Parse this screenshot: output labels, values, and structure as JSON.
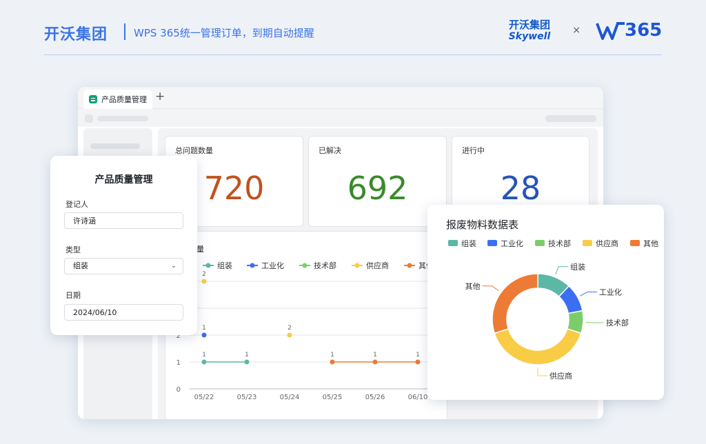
{
  "header": {
    "brand": "开沃集团",
    "subtitle": "WPS 365统一管理订单，到期自动提醒",
    "partner_cn": "开沃集团",
    "partner_en": "Skywell",
    "times": "×",
    "partner2": "365"
  },
  "window": {
    "tab_label": "产品质量管理",
    "tab_add": "+",
    "stats": [
      {
        "label": "总问题数量",
        "value": "720",
        "color": "#c0521c"
      },
      {
        "label": "已解决",
        "value": "692",
        "color": "#3a8a2a"
      },
      {
        "label": "进行中",
        "value": "28",
        "color": "#2454b8"
      }
    ]
  },
  "form": {
    "title": "产品质量管理",
    "fields": [
      {
        "label": "登记人",
        "value": "许诗涵"
      },
      {
        "label": "类型",
        "value": "组装"
      },
      {
        "label": "日期",
        "value": "2024/06/10"
      }
    ]
  },
  "colors": {
    "组装": "#5bb7a6",
    "工业化": "#3b6ff2",
    "技术部": "#7ccd6a",
    "供应商": "#f8cc45",
    "其他": "#ee7b35"
  },
  "chart_data": [
    {
      "type": "line",
      "title": "反馈数量",
      "legend": [
        "组装",
        "工业化",
        "技术部",
        "供应商",
        "其他"
      ],
      "legend_position": "top",
      "x": [
        "05/22",
        "05/23",
        "05/24",
        "05/25",
        "05/26",
        "06/10"
      ],
      "y_ticks": [
        0,
        1,
        2
      ],
      "grid": true,
      "series": [
        {
          "name": "组装",
          "points": [
            {
              "x": "05/22",
              "y": 1
            },
            {
              "x": "05/23",
              "y": 1
            }
          ]
        },
        {
          "name": "工业化",
          "points": [
            {
              "x": "05/22",
              "y": 2,
              "label": "1"
            }
          ]
        },
        {
          "name": "供应商",
          "points": [
            {
              "x": "05/22",
              "y": 4,
              "label": "2"
            },
            {
              "x": "05/24",
              "y": 2
            }
          ]
        },
        {
          "name": "其他",
          "points": [
            {
              "x": "05/25",
              "y": 1
            },
            {
              "x": "05/26",
              "y": 1
            },
            {
              "x": "06/10",
              "y": 1
            }
          ]
        }
      ]
    },
    {
      "type": "pie",
      "title": "报废物料数据表",
      "legend": [
        "组装",
        "工业化",
        "技术部",
        "供应商",
        "其他"
      ],
      "legend_position": "top",
      "slices": [
        {
          "label": "组装",
          "value": 12
        },
        {
          "label": "工业化",
          "value": 10
        },
        {
          "label": "技术部",
          "value": 8
        },
        {
          "label": "供应商",
          "value": 40
        },
        {
          "label": "其他",
          "value": 30
        }
      ]
    }
  ]
}
